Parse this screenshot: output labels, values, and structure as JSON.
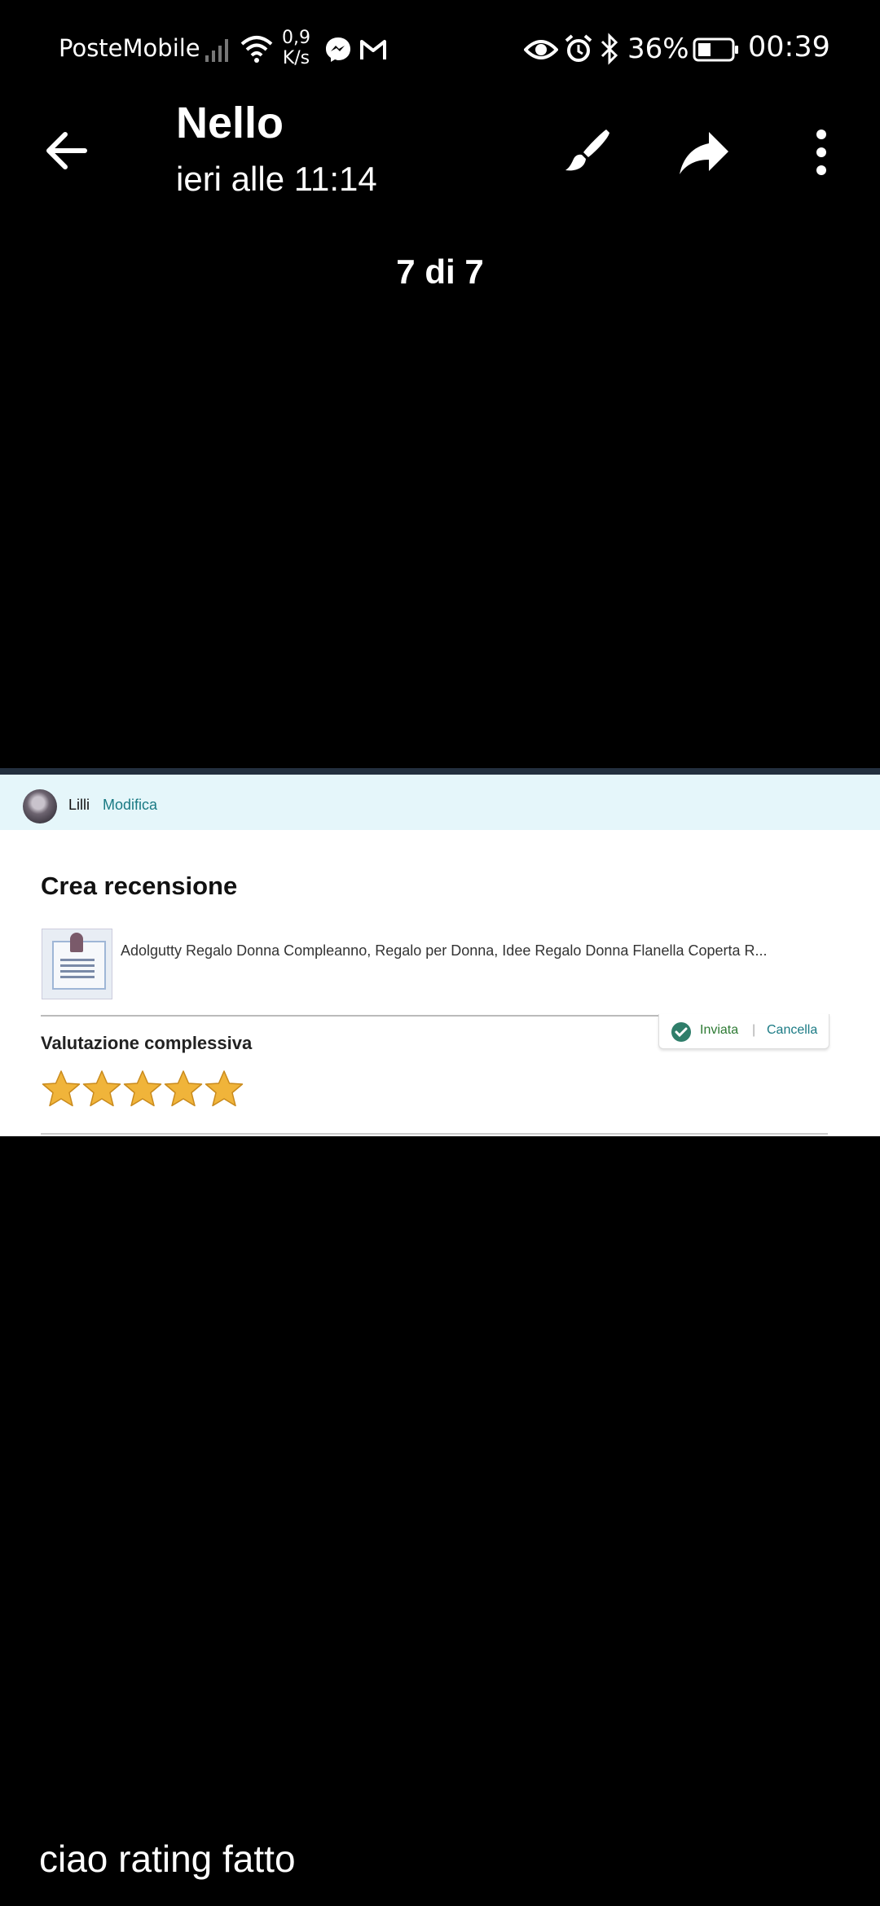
{
  "status_bar": {
    "carrier": "PosteMobile",
    "speed_value": "0,9",
    "speed_unit": "K/s",
    "battery_percent": "36%",
    "time": "00:39",
    "icons": [
      "signal-icon",
      "wifi-icon",
      "messenger-icon",
      "gmail-icon",
      "eye-icon",
      "alarm-icon",
      "bluetooth-icon",
      "battery-icon"
    ]
  },
  "app_bar": {
    "title": "Nello",
    "subtitle": "ieri alle 11:14",
    "actions": [
      "back-icon",
      "brush-icon",
      "share-icon",
      "more-icon"
    ]
  },
  "counter": "7 di 7",
  "review_screenshot": {
    "user_name": "Lilli",
    "edit_label": "Modifica",
    "heading": "Crea recensione",
    "product_title": "Adolgutty Regalo Donna Compleanno, Regalo per Donna, Idee Regalo Donna Flanella Coperta R...",
    "rating_heading": "Valutazione complessiva",
    "status_sent": "Inviata",
    "separator": "|",
    "cancel_label": "Cancella",
    "rating": 5,
    "rating_max": 5,
    "colors": {
      "star": "#f0b43a",
      "link": "#1a7a84",
      "sent": "#2d7a33",
      "user_bar": "#e5f6fa"
    }
  },
  "caption": "ciao rating fatto"
}
